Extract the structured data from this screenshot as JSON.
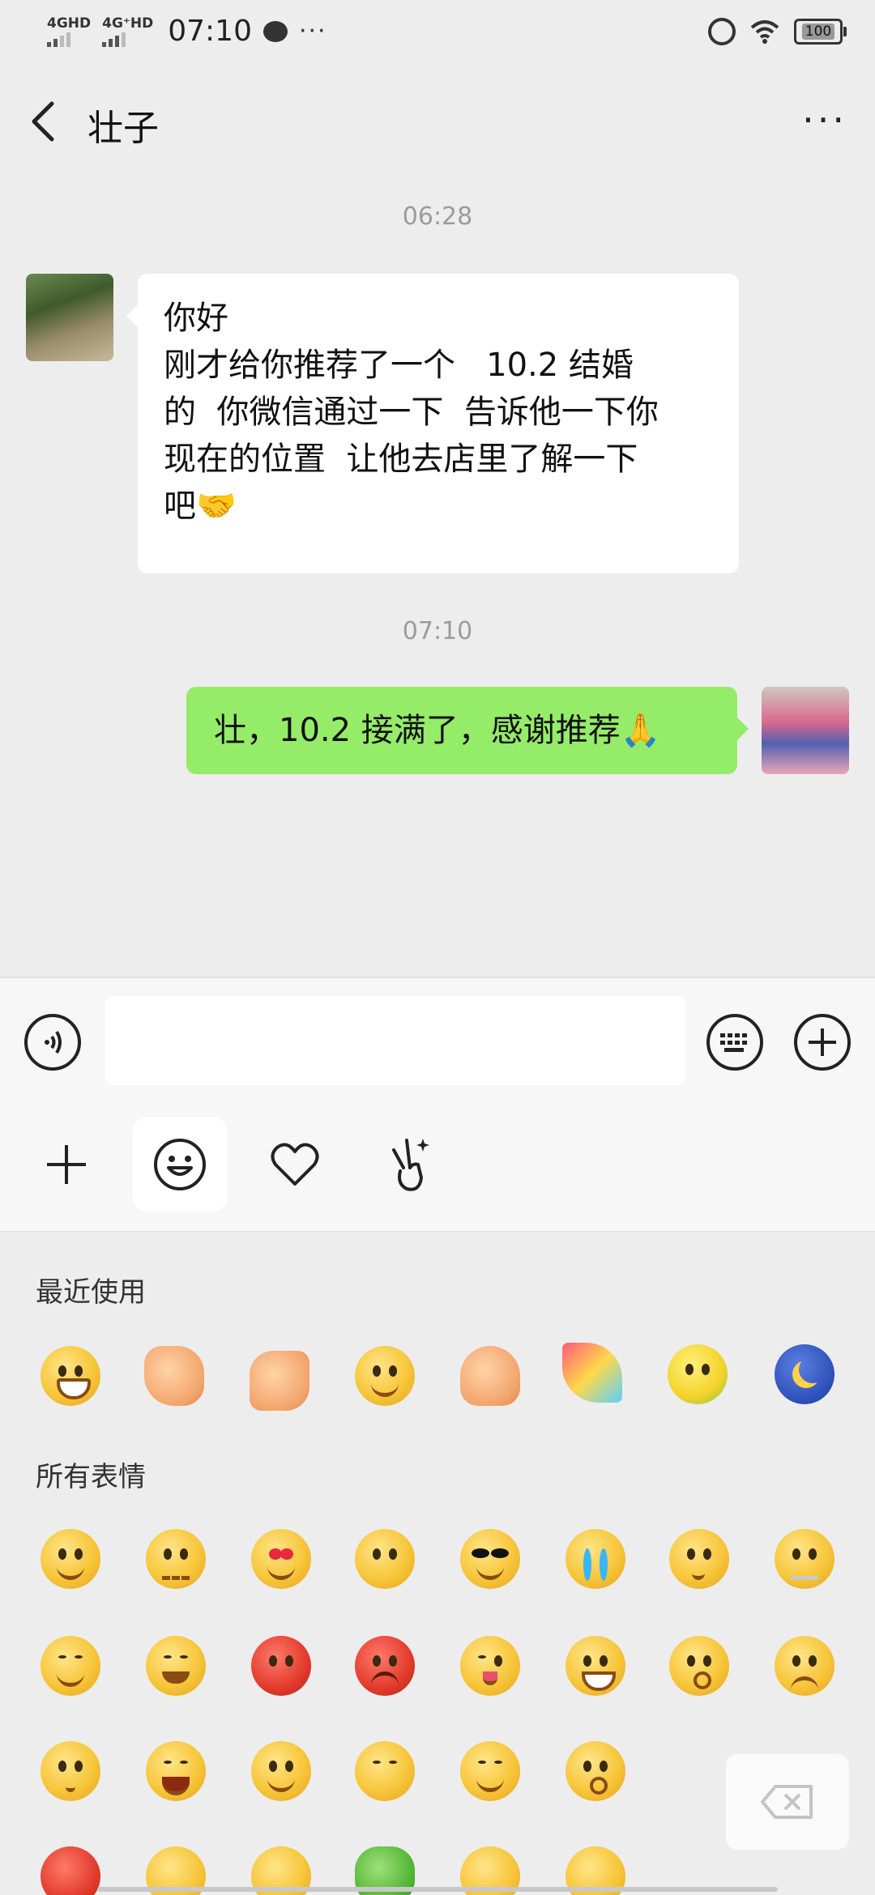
{
  "status_bar": {
    "network1": "4GHD",
    "network2": "4G⁺HD",
    "time": "07:10",
    "more_indicator": "···",
    "battery": "100"
  },
  "header": {
    "title": "壮子",
    "more_label": "···"
  },
  "messages": [
    {
      "type": "timestamp",
      "text": "06:28"
    },
    {
      "type": "incoming",
      "lines": [
        "你好",
        "刚才给你推荐了一个   10.2 结婚",
        "的  你微信通过一下  告诉他一下你",
        "现在的位置  让他去店里了解一下",
        "吧🤝"
      ]
    },
    {
      "type": "timestamp",
      "text": "07:10"
    },
    {
      "type": "outgoing",
      "text": "壮，10.2 接满了，感谢推荐🙏"
    }
  ],
  "input": {
    "value": "",
    "placeholder": ""
  },
  "emoji_panel": {
    "recent_label": "最近使用",
    "all_label": "所有表情",
    "recent": [
      "grin-icon",
      "hands-icon",
      "handshake-icon",
      "smile-icon",
      "ok-hand-icon",
      "party-icon",
      "chick-icon",
      "moon-icon"
    ]
  },
  "colors": {
    "background": "#ededed",
    "outgoing_bubble": "#95ec69",
    "incoming_bubble": "#ffffff"
  }
}
